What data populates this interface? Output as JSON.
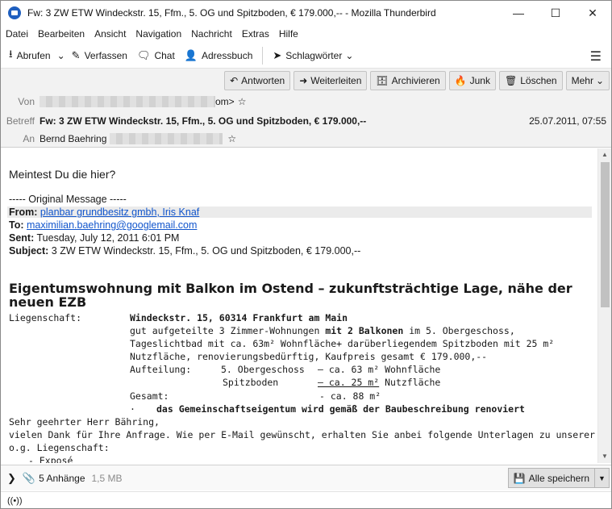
{
  "window": {
    "title": "Fw: 3 ZW ETW Windeckstr. 15, Ffm., 5. OG und Spitzboden, € 179.000,-- - Mozilla Thunderbird"
  },
  "menu": [
    "Datei",
    "Bearbeiten",
    "Ansicht",
    "Navigation",
    "Nachricht",
    "Extras",
    "Hilfe"
  ],
  "toolbar": {
    "get": "Abrufen",
    "compose": "Verfassen",
    "chat": "Chat",
    "addressbook": "Adressbuch",
    "tags": "Schlagwörter"
  },
  "actions": {
    "reply": "Antworten",
    "forward": "Weiterleiten",
    "archive": "Archivieren",
    "junk": "Junk",
    "delete": "Löschen",
    "more": "Mehr"
  },
  "header": {
    "from_label": "Von",
    "from_tail": "om>",
    "subject_label": "Betreff",
    "subject": "Fw: 3 ZW ETW Windeckstr. 15, Ffm., 5. OG und Spitzboden, € 179.000,--",
    "to_label": "An",
    "to": "Bernd Baehring",
    "date": "25.07.2011, 07:55"
  },
  "body": {
    "greeting": "Meintest Du die hier?",
    "orig": "----- Original Message -----",
    "from_k": "From:",
    "from_v": "planbar grundbesitz gmbh, Iris Knaf",
    "to_k": "To:",
    "to_v": "maximilian.baehring@googlemail.com",
    "sent_k": "Sent:",
    "sent_v": "Tuesday, July 12, 2011 6:01 PM",
    "subj_k": "Subject:",
    "subj_v": "3 ZW ETW Windeckstr. 15, Ffm., 5. OG und Spitzboden, € 179.000,--",
    "headline": "Eigentumswohnung mit Balkon im Ostend – zukunftsträchtige Lage, nähe der neuen EZB",
    "liegenschaft": "Liegenschaft:",
    "addr": "Windeckstr. 15, 60314 Frankfurt am Main",
    "l1a": "gut aufgeteilte 3 Zimmer-Wohnungen ",
    "l1b": "mit 2 Balkonen",
    "l1c": " im 5. Obergeschoss,",
    "l2": "Tageslichtbad mit ca. 63m² Wohnfläche+ darüberliegendem Spitzboden mit 25 m²",
    "l3": "Nutzfläche, renovierungsbedürftig, Kaufpreis gesamt € 179.000,--",
    "auf": "Aufteilung:",
    "og": "5. Obergeschoss",
    "og_v": "– ca. 63 m² Wohnfläche",
    "sb": "Spitzboden",
    "sb_v1": "– ca. 25 m²",
    "sb_v2": " Nutzfläche",
    "ges": "Gesamt:",
    "ges_v": "- ca. 88 m²",
    "bullet": "·",
    "bullet_t": "das Gemeinschaftseigentum wird gemäß der Baubeschreibung renoviert",
    "sal": "Sehr geehrter Herr Bähring,",
    "p1": "vielen Dank für Ihre Anfrage. Wie per E-Mail gewünscht, erhalten Sie anbei folgende Unterlagen zu unserer",
    "p2": "o.g. Liegenschaft:",
    "li1": "-      Exposé"
  },
  "attachments": {
    "count": "5 Anhänge",
    "size": "1,5 MB",
    "save": "Alle speichern"
  }
}
